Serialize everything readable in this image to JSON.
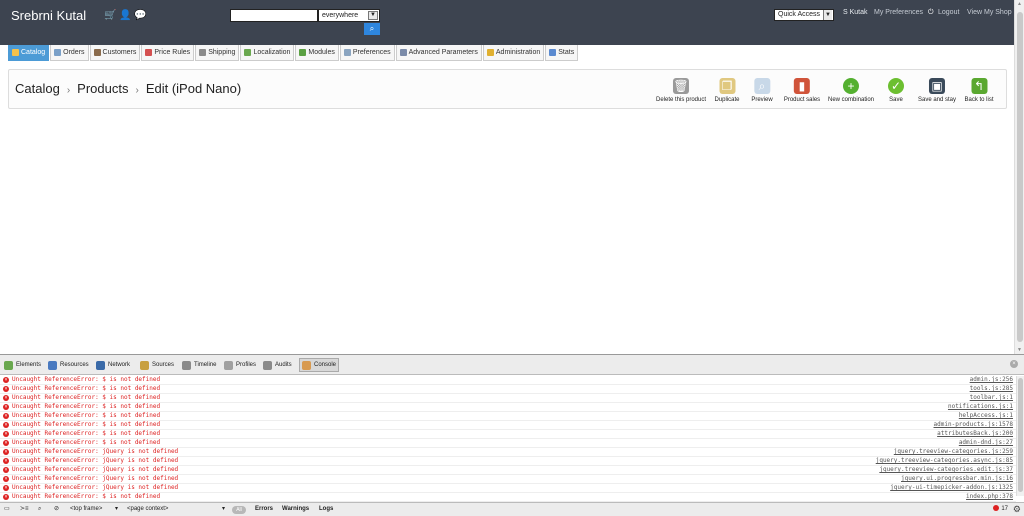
{
  "header": {
    "shop_name": "Srebrni Kutal",
    "icons": [
      "cart-icon",
      "customers-icon",
      "messages-icon"
    ],
    "search": {
      "value": "",
      "scope": "everywhere"
    },
    "quick_access": "Quick Access",
    "user_name": "S Kutak",
    "my_preferences": "My Preferences",
    "logout": "Logout",
    "view_shop": "View My Shop"
  },
  "nav": {
    "tabs": [
      {
        "label": "Catalog",
        "active": true,
        "color": "#f6c24c"
      },
      {
        "label": "Orders",
        "color": "#7aa0c8"
      },
      {
        "label": "Customers",
        "color": "#8a6b4c"
      },
      {
        "label": "Price Rules",
        "color": "#d45050"
      },
      {
        "label": "Shipping",
        "color": "#8a8a8a"
      },
      {
        "label": "Localization",
        "color": "#6aa84f"
      },
      {
        "label": "Modules",
        "color": "#5ba043"
      },
      {
        "label": "Preferences",
        "color": "#8aa4c0"
      },
      {
        "label": "Advanced Parameters",
        "color": "#7a8aa8"
      },
      {
        "label": "Administration",
        "color": "#e0b030"
      },
      {
        "label": "Stats",
        "color": "#5a8ad0"
      }
    ]
  },
  "breadcrumb": {
    "catalog": "Catalog",
    "sep": "›",
    "products": "Products",
    "edit": "Edit (iPod Nano)"
  },
  "toolbar": {
    "buttons": [
      {
        "label": "Delete this product",
        "icon": "trash-icon",
        "color": "#9a9a9a",
        "glyph": "🗑"
      },
      {
        "label": "Duplicate",
        "icon": "duplicate-icon",
        "color": "#e0c880",
        "glyph": "❐"
      },
      {
        "label": "Preview",
        "icon": "preview-icon",
        "color": "#c8d8e8",
        "glyph": "⌕"
      },
      {
        "label": "Product sales",
        "icon": "chart-icon",
        "color": "#d0543a",
        "glyph": "▮"
      },
      {
        "label": "New combination",
        "icon": "add-icon",
        "color": "#54b030",
        "glyph": "+"
      },
      {
        "label": "Save",
        "icon": "check-icon",
        "color": "#6cbf30",
        "glyph": "✓"
      },
      {
        "label": "Save and stay",
        "icon": "floppy-icon",
        "color": "#3a4a5a",
        "glyph": "▣"
      },
      {
        "label": "Back to list",
        "icon": "back-arrow-icon",
        "color": "#5aa830",
        "glyph": "↰"
      }
    ]
  },
  "devtools": {
    "tabs": [
      {
        "label": "Elements",
        "color": "#6aa84f"
      },
      {
        "label": "Resources",
        "color": "#4a7ac0"
      },
      {
        "label": "Network",
        "color": "#3a6aa8"
      },
      {
        "label": "Sources",
        "color": "#c8a040"
      },
      {
        "label": "Timeline",
        "color": "#8a8a8a"
      },
      {
        "label": "Profiles",
        "color": "#a0a0a0"
      },
      {
        "label": "Audits",
        "color": "#8a8a8a"
      },
      {
        "label": "Console",
        "color": "#d89a50",
        "active": true
      }
    ],
    "console": [
      {
        "msg": "Uncaught ReferenceError: $ is not defined",
        "src": "admin.js:256"
      },
      {
        "msg": "Uncaught ReferenceError: $ is not defined",
        "src": "tools.js:285"
      },
      {
        "msg": "Uncaught ReferenceError: $ is not defined",
        "src": "toolbar.js:1"
      },
      {
        "msg": "Uncaught ReferenceError: $ is not defined",
        "src": "notifications.js:1"
      },
      {
        "msg": "Uncaught ReferenceError: $ is not defined",
        "src": "helpAccess.js:1"
      },
      {
        "msg": "Uncaught ReferenceError: $ is not defined",
        "src": "admin-products.js:1578"
      },
      {
        "msg": "Uncaught ReferenceError: $ is not defined",
        "src": "attributesBack.js:200"
      },
      {
        "msg": "Uncaught ReferenceError: $ is not defined",
        "src": "admin-dnd.js:27"
      },
      {
        "msg": "Uncaught ReferenceError: jQuery is not defined",
        "src": "jquery.treeview-categories.js:259"
      },
      {
        "msg": "Uncaught ReferenceError: jQuery is not defined",
        "src": "jquery.treeview-categories.async.js:85"
      },
      {
        "msg": "Uncaught ReferenceError: jQuery is not defined",
        "src": "jquery.treeview-categories.edit.js:37"
      },
      {
        "msg": "Uncaught ReferenceError: jQuery is not defined",
        "src": "jquery.ui.progressbar.min.js:16"
      },
      {
        "msg": "Uncaught ReferenceError: jQuery is not defined",
        "src": "jquery-ui-timepicker-addon.js:1325"
      },
      {
        "msg": "Uncaught ReferenceError: $ is not defined",
        "src": "index.php:378"
      }
    ],
    "status": {
      "frame": "<top frame>",
      "context": "<page context>",
      "filter_all": "All",
      "errors": "Errors",
      "warnings": "Warnings",
      "logs": "Logs",
      "error_count": "17"
    }
  }
}
